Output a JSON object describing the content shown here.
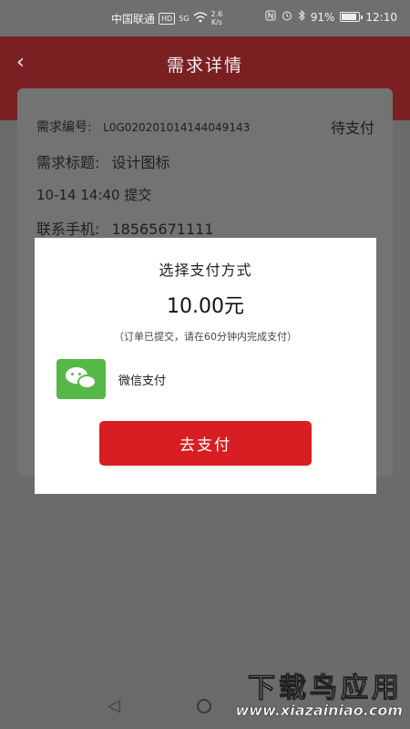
{
  "status_bar": {
    "carrier": "中国联通",
    "hd": "HD",
    "network_gen": "5G",
    "speed_value": "2.6",
    "speed_unit": "K/s",
    "battery": "91%",
    "time": "12:10"
  },
  "header": {
    "back_icon": "‹",
    "title": "需求详情"
  },
  "detail": {
    "number_label": "需求编号:",
    "number_value": "L0G020201014144049143",
    "status": "待支付",
    "title_label": "需求标题:",
    "title_value": "设计图标",
    "submitted": "10-14 14:40 提交",
    "phone_label": "联系手机:",
    "phone_value": "18565671111"
  },
  "modal": {
    "title": "选择支付方式",
    "amount": "10.00元",
    "hint": "（订单已提交，请在60分钟内完成支付）",
    "option_label": "微信支付",
    "button_label": "去支付",
    "accent_color": "#d81e22",
    "wechat_color": "#55b847"
  },
  "nav": {
    "back_icon": "◁"
  },
  "watermark": {
    "line1": "下载鸟应用",
    "line2": "www.xiazainiao.com"
  }
}
